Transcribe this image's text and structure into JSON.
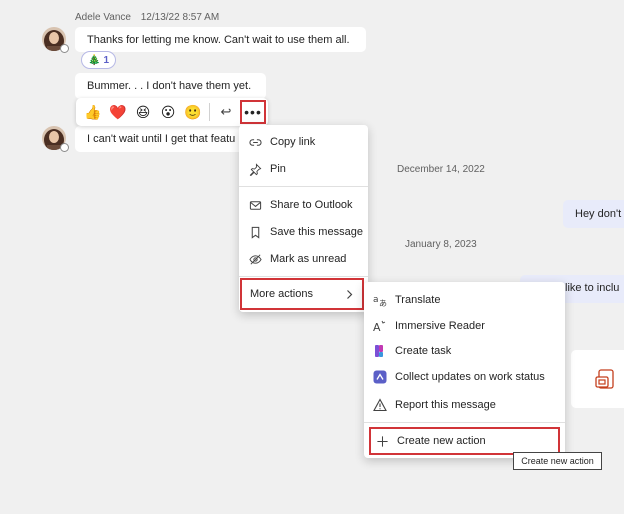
{
  "messages": {
    "sender": {
      "name": "Adele Vance",
      "timestamp": "12/13/22 8:57 AM"
    },
    "msg1": "Thanks for letting me know. Can't wait to use them all.",
    "reaction": {
      "emoji": "🎄",
      "count": "1"
    },
    "msg2": "Bummer. . . I don't have them yet.",
    "msg3": "I can't wait until I get that featu",
    "right_msg": "Hey don't",
    "right_msg2": "like to inclu"
  },
  "dates": {
    "d1": "December 14, 2022",
    "d2": "January 8, 2023"
  },
  "reaction_bar": {
    "emojis": [
      "👍",
      "❤️",
      "😆",
      "😮",
      "🙂"
    ],
    "reply_icon": "↩",
    "more_label": "•••"
  },
  "context_menu": {
    "items": [
      {
        "label": "Copy link",
        "icon": "link-icon"
      },
      {
        "label": "Pin",
        "icon": "pin-icon"
      },
      {
        "label": "Share to Outlook",
        "icon": "mail-icon"
      },
      {
        "label": "Save this message",
        "icon": "bookmark-icon"
      },
      {
        "label": "Mark as unread",
        "icon": "unread-icon"
      },
      {
        "label": "More actions",
        "icon": "chevron-right-icon"
      }
    ]
  },
  "more_actions_menu": {
    "items": [
      {
        "label": "Translate",
        "icon": "translate-icon"
      },
      {
        "label": "Immersive Reader",
        "icon": "immersive-reader-icon"
      },
      {
        "label": "Create task",
        "icon": "planner-icon"
      },
      {
        "label": "Collect updates on work status",
        "icon": "updates-icon"
      },
      {
        "label": "Report this message",
        "icon": "warning-icon"
      },
      {
        "label": "Create new action",
        "icon": "plus-icon"
      }
    ]
  },
  "tooltip": "Create new action",
  "colors": {
    "highlight": "#d13438",
    "brand": "#5b5fc7",
    "background": "#f0f0f0"
  }
}
